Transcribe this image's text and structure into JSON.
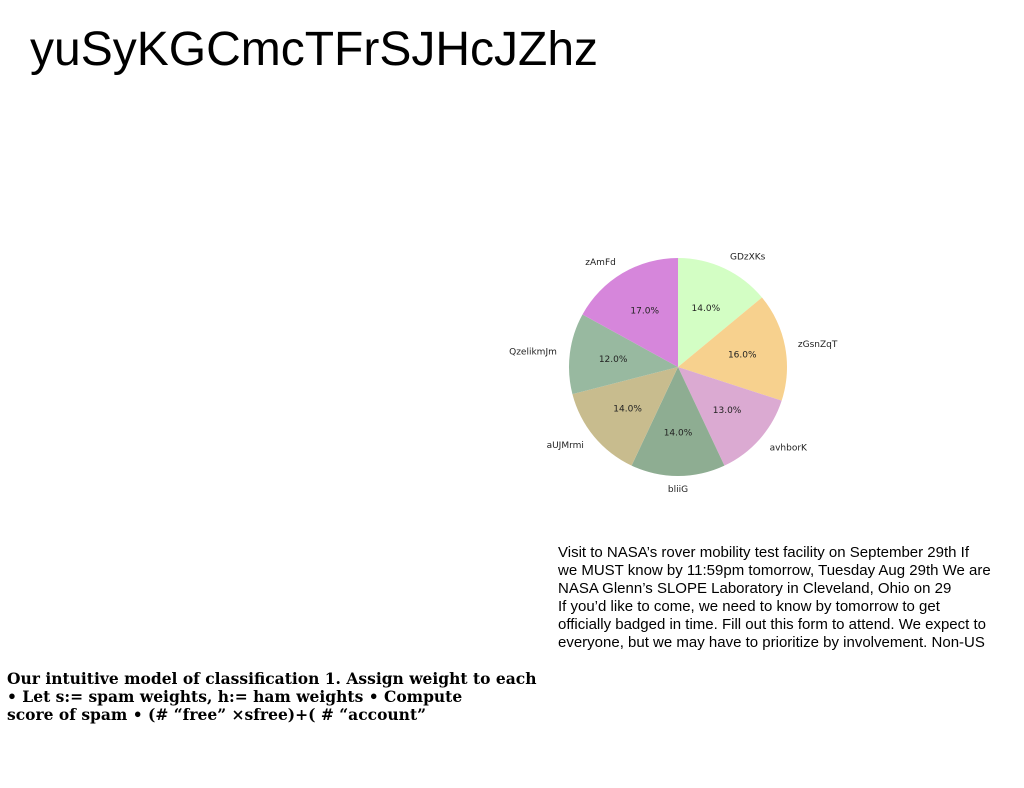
{
  "title": "yuSyKGCmcTFrSJHcJZhz",
  "chart_data": {
    "type": "pie",
    "categories": [
      "GDzXKs",
      "zGsnZqT",
      "avhborK",
      "bliiG",
      "aUJMrmi",
      "QzelikmJm",
      "zAmFd"
    ],
    "values": [
      14.0,
      16.0,
      13.0,
      14.0,
      14.0,
      12.0,
      17.0
    ],
    "value_labels": [
      "14.0%",
      "16.0%",
      "13.0%",
      "14.0%",
      "14.0%",
      "12.0%",
      "17.0%"
    ],
    "colors": [
      "#d3fec4",
      "#f7d18e",
      "#dbaad2",
      "#8ead92",
      "#c8bc8e",
      "#98b9a0",
      "#d686db"
    ],
    "start_angle": 90,
    "direction": "clockwise"
  },
  "notice": {
    "lines": [
      "Visit to NASA’s rover mobility test facility on September 29th If",
      "we MUST know by 11:59pm tomorrow, Tuesday Aug 29th We are",
      "NASA Glenn’s SLOPE Laboratory in Cleveland, Ohio on 29",
      "If you’d like to come, we need to know by tomorrow to get",
      "officially badged in time. Fill out this form to attend. We expect to",
      "everyone, but we may have to prioritize by involvement. Non-US"
    ]
  },
  "model": {
    "lines": [
      "Our intuitive model of classification 1. Assign weight to each",
      "• Let s:= spam weights, h:= ham weights • Compute",
      "score of spam • (# “free” ×sfree)+( # “account”"
    ]
  }
}
